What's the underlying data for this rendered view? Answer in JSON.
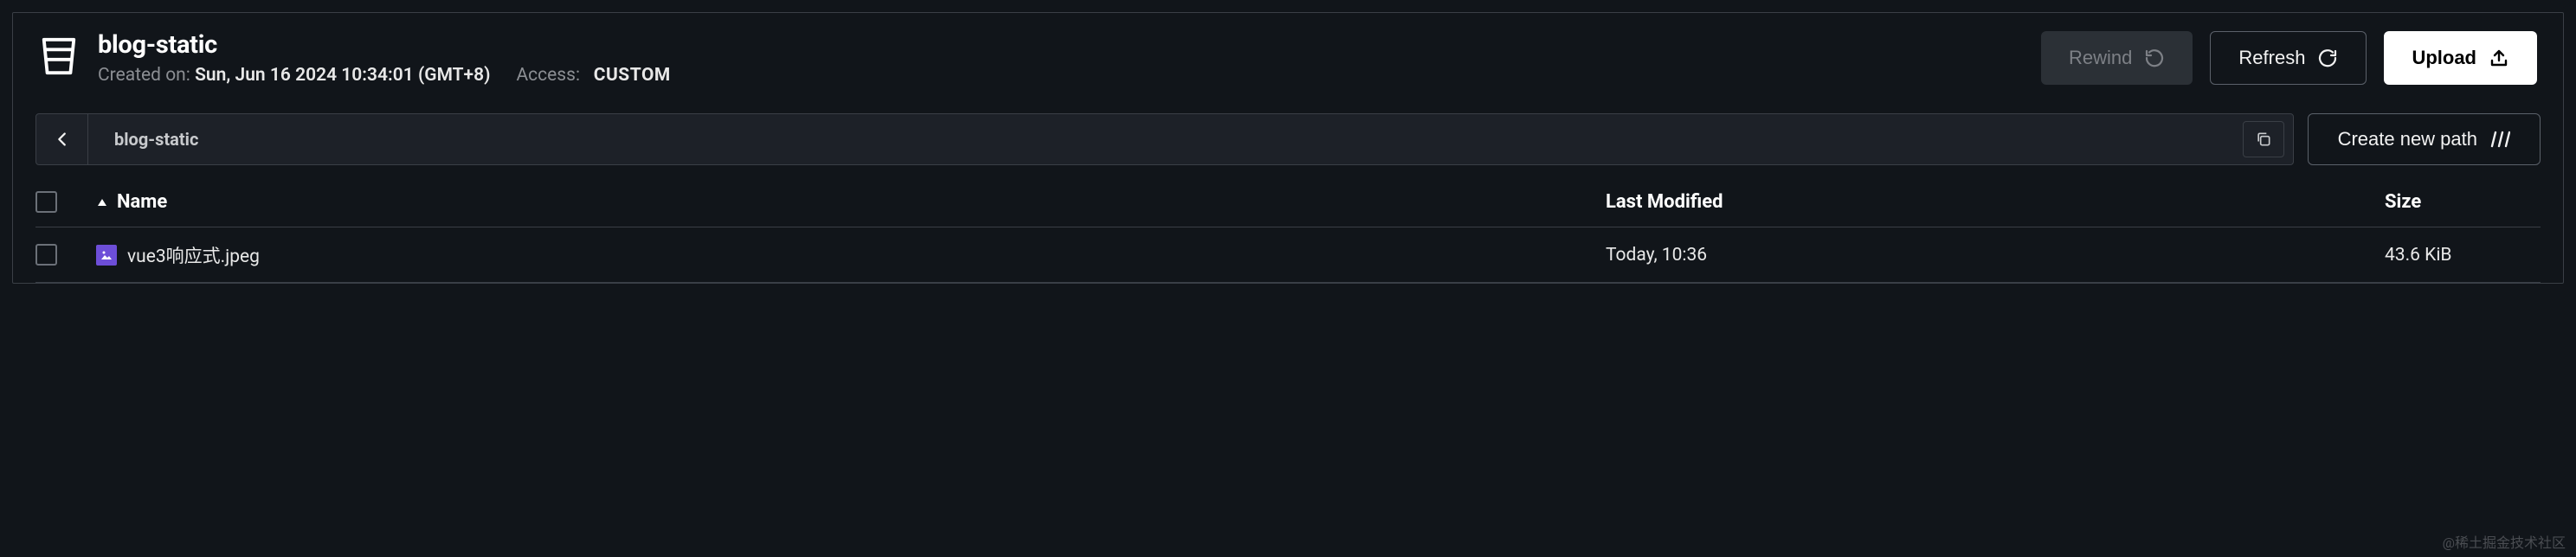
{
  "header": {
    "title": "blog-static",
    "created_label": "Created on:",
    "created_value": "Sun, Jun 16 2024 10:34:01 (GMT+8)",
    "access_label": "Access:",
    "access_value": "CUSTOM"
  },
  "actions": {
    "rewind": "Rewind",
    "refresh": "Refresh",
    "upload": "Upload",
    "create_path": "Create new path"
  },
  "breadcrumb": {
    "path": "blog-static"
  },
  "table": {
    "columns": {
      "name": "Name",
      "modified": "Last Modified",
      "size": "Size"
    },
    "rows": [
      {
        "name": "vue3响应式.jpeg",
        "modified": "Today, 10:36",
        "size": "43.6 KiB"
      }
    ]
  },
  "watermark": "@稀土掘金技术社区"
}
